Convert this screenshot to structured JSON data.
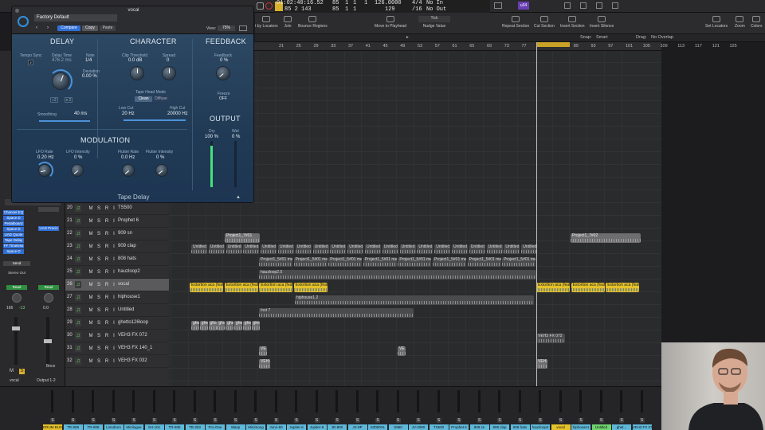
{
  "lcd": {
    "position_time": "01:02:40:16.52",
    "position_bars": "85  2  143",
    "cell_a1": "85",
    "cell_a2": "1",
    "cell_a3": "1",
    "cell_a4": "1",
    "cell_b1": "85",
    "cell_b2": "1",
    "cell_b3": "1",
    "tempo": "126.0000",
    "tempo_sub": "129",
    "signature": "4/4",
    "division": "/16",
    "in": "No In",
    "out": "No Out",
    "cpu_badge": "u34"
  },
  "toolbar": {
    "set_by_locators": "t by Locators",
    "join": "Join",
    "bounce_regions": "Bounce Regions",
    "move_to_playhead": "Move to Playhead",
    "nudge_label": "Tick",
    "nudge_value": "Nudge Value",
    "repeat_section": "Repeat Section",
    "cut_section": "Cut Section",
    "insert_section": "Insert Section",
    "insert_silence": "Insert Silence",
    "set_locators": "Set Locators",
    "zoom": "Zoom",
    "colors": "Colors"
  },
  "menurow": {
    "snap_label": "Snap:",
    "snap_value": "Smart",
    "drag_label": "Drag:",
    "drag_value": "No Overlap"
  },
  "ruler": [
    "21",
    "25",
    "29",
    "33",
    "37",
    "41",
    "45",
    "49",
    "53",
    "57",
    "61",
    "65",
    "69",
    "73",
    "77",
    "81",
    "85",
    "89",
    "93",
    "97",
    "101",
    "105",
    "109",
    "113",
    "117",
    "121",
    "125"
  ],
  "plugin": {
    "window_title": "vocal",
    "preset": "Factory Default",
    "compare": "Compare",
    "copy": "Copy",
    "paste": "Paste",
    "view_label": "View:",
    "view_value": "75%",
    "delay_title": "DELAY",
    "character_title": "CHARACTER",
    "feedback_title": "FEEDBACK",
    "modulation_title": "MODULATION",
    "output_title": "OUTPUT",
    "tempo_sync": "Tempo Sync",
    "delay_time_label": "Delay Time",
    "delay_time_value": "476.2 ms",
    "note_label": "Note",
    "note_value": "1/4",
    "deviation_label": "Deviation",
    "deviation_value": "0.00 %",
    "div_half": "÷2",
    "mult_two": "x 2",
    "clip_threshold_label": "Clip Threshold",
    "clip_threshold_value": "0.0 dB",
    "spread_label": "Spread",
    "spread_value": "0",
    "tape_head_mode": "Tape Head Mode",
    "clean": "Clean",
    "diffuse": "Diffuse",
    "low_cut_label": "Low Cut",
    "low_cut_value": "20 Hz",
    "high_cut_label": "High Cut",
    "high_cut_value": "20000 Hz",
    "feedback_label": "Feedback",
    "feedback_value": "0 %",
    "freeze_label": "Freeze",
    "freeze_value": "OFF",
    "smoothing_label": "Smoothing",
    "smoothing_value": "40 ms",
    "lfo_rate_label": "LFO Rate",
    "lfo_rate_value": "0.20 Hz",
    "lfo_intensity_label": "LFO Intensity",
    "lfo_intensity_value": "0 %",
    "flutter_rate_label": "Flutter Rate",
    "flutter_rate_value": "0.0 Hz",
    "flutter_intensity_label": "Flutter Intensity",
    "flutter_intensity_value": "0 %",
    "dry_label": "Dry",
    "dry_value": "100 %",
    "wet_label": "Wet",
    "wet_value": "0 %",
    "footer": "Tape Delay"
  },
  "inspector": {
    "plugins": [
      "Channel EQ",
      "Space D",
      "Pedalboard",
      "Space D",
      "UAD Quote",
      "Tape Delay",
      "FF Timeless",
      "Space D"
    ],
    "uad_precis": "UAD Precis",
    "send": "Send",
    "stereo_out": "Stereo Out",
    "read_a": "Read",
    "read_b": "Read",
    "vol_a": "166",
    "vol_a2": "-13",
    "vol_b": "0.0",
    "m_a": "M",
    "s_a": "S",
    "bnce": "Bnce",
    "name_a": "vocal",
    "name_b": "Output 1-2"
  },
  "tracks": [
    {
      "num": "20",
      "name": "TS500",
      "m": "M",
      "s": "S",
      "r": "R",
      "i": "I",
      "sel": false
    },
    {
      "num": "21",
      "name": "Prophet 6",
      "m": "M",
      "s": "S",
      "r": "R",
      "i": "I",
      "sel": false
    },
    {
      "num": "22",
      "name": "909 sn",
      "m": "M",
      "s": "S",
      "r": "R",
      "i": "I",
      "sel": false
    },
    {
      "num": "23",
      "name": "909 clap",
      "m": "M",
      "s": "S",
      "r": "R",
      "i": "I",
      "sel": false
    },
    {
      "num": "24",
      "name": "808 hats",
      "m": "M",
      "s": "S",
      "r": "R",
      "i": "I",
      "sel": false
    },
    {
      "num": "25",
      "name": "hauzloop2",
      "m": "M",
      "s": "S",
      "r": "R",
      "i": "I",
      "sel": false
    },
    {
      "num": "26",
      "name": "vocal",
      "m": "M",
      "s": "S",
      "r": "R",
      "i": "I",
      "sel": true
    },
    {
      "num": "27",
      "name": "hiphouse1",
      "m": "M",
      "s": "S",
      "r": "R",
      "i": "I",
      "sel": false
    },
    {
      "num": "28",
      "name": "Untitled",
      "m": "M",
      "s": "S",
      "r": "R",
      "i": "I",
      "sel": false
    },
    {
      "num": "29",
      "name": "ghetto126loop",
      "m": "M",
      "s": "S",
      "r": "R",
      "i": "I",
      "sel": false
    },
    {
      "num": "30",
      "name": "VEH3 FX 072",
      "m": "M",
      "s": "S",
      "r": "R",
      "i": "I",
      "sel": false
    },
    {
      "num": "31",
      "name": "VEH3 FX 140_1",
      "m": "M",
      "s": "S",
      "r": "R",
      "i": "I",
      "sel": false
    },
    {
      "num": "32",
      "name": "VEH3 FX 032",
      "m": "M",
      "s": "S",
      "r": "R",
      "i": "I",
      "sel": false
    }
  ],
  "regions": {
    "project1_7601": "Project1_7#01",
    "project1_7602": "Project1_7#02",
    "untitled": "Untitled",
    "merge": "Project1_5#01 merg",
    "hauzloop": "hauzloop2.5",
    "extortion": "Extortion aca (feat.)",
    "hiphouse": "hiphouse1.2",
    "inst7": "Inst 7",
    "ghetto": "ghe",
    "veh_a": "VEH3 FX 072",
    "veh_b": "VE",
    "veh_c": "VEH3"
  },
  "mixer": [
    "DRUM BUS",
    "TR-909",
    "TR-808",
    "Linndrum",
    "Minilogue",
    "SH-101",
    "TR-606",
    "TB-303",
    "Pro-One",
    "Wasp",
    "Minimoog",
    "Juno-60",
    "Jupiter-6",
    "Jupiter-8",
    "JD-800",
    "JX-8P",
    "S3000XL",
    "S950",
    "JV-2080",
    "TS500",
    "Prophet 6",
    "909 sn",
    "909 clap",
    "808 hats",
    "hauzloop2",
    "vocal",
    "hiphouse1",
    "Untitled",
    "ghet...",
    "VEH3 FX 072"
  ],
  "colors": {
    "accent_yellow": "#e5c22a",
    "plugin_blue": "#4c92d9",
    "slot_blue": "#2f6fd6",
    "track_green": "#6fd36f"
  }
}
